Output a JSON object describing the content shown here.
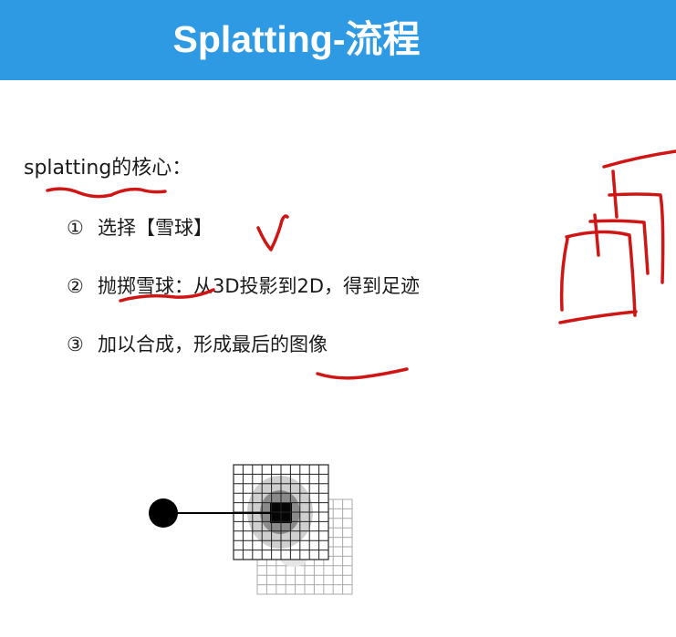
{
  "header": {
    "title": "Splatting-流程"
  },
  "intro": {
    "text": "splatting的核心："
  },
  "steps": [
    {
      "number": "①",
      "text": "选择【雪球】"
    },
    {
      "number": "②",
      "text": "抛掷雪球：从3D投影到2D，得到足迹"
    },
    {
      "number": "③",
      "text": "加以合成，形成最后的图像"
    }
  ],
  "colors": {
    "header": "#2f9ae4",
    "annotation": "#d01515"
  }
}
